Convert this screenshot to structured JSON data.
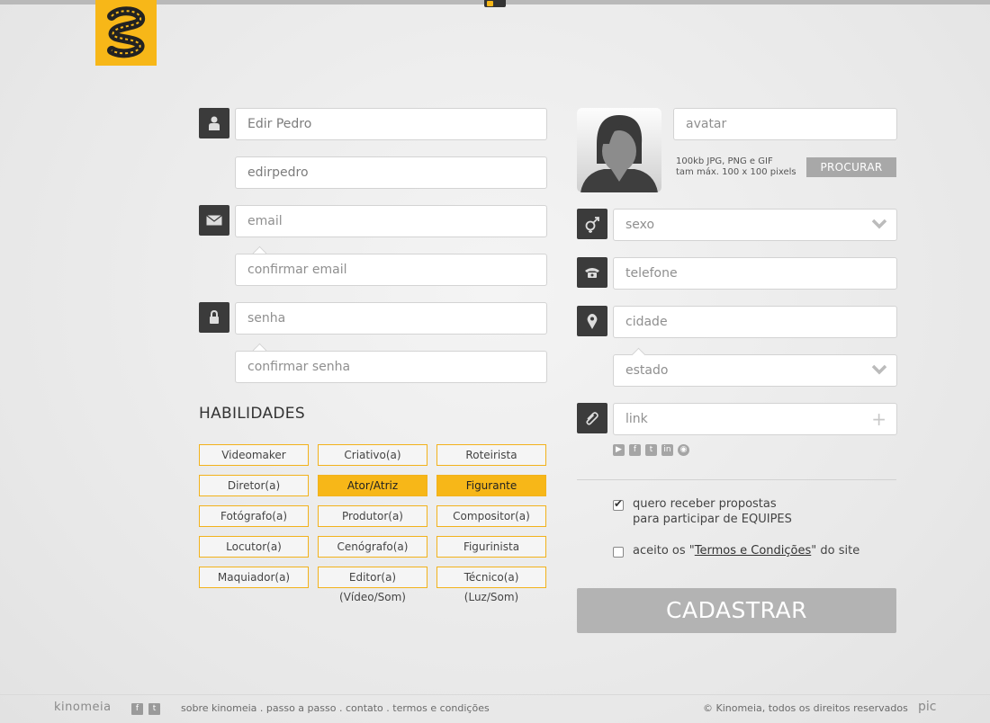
{
  "icons": {
    "user": "user-icon",
    "mail": "envelope-icon",
    "lock": "lock-icon",
    "gender": "gender-icon",
    "phone": "phone-icon",
    "location": "location-pin-icon",
    "clip": "paperclip-icon"
  },
  "colors": {
    "accent": "#f7b718",
    "dark": "#3b3b3b",
    "button": "#b3b3b3"
  },
  "form": {
    "nome": {
      "value": "Edir Pedro"
    },
    "usuario": {
      "value": "edirpedro"
    },
    "email": {
      "placeholder": "email"
    },
    "confirmar_email": {
      "placeholder": "confirmar email"
    },
    "senha": {
      "placeholder": "senha"
    },
    "confirmar_senha": {
      "placeholder": "confirmar senha"
    }
  },
  "skills": {
    "title": "HABILIDADES",
    "items": [
      {
        "label": "Videomaker",
        "selected": false
      },
      {
        "label": "Criativo(a)",
        "selected": false
      },
      {
        "label": "Roteirista",
        "selected": false
      },
      {
        "label": "Diretor(a)",
        "selected": false
      },
      {
        "label": "Ator/Atriz",
        "selected": true
      },
      {
        "label": "Figurante",
        "selected": true
      },
      {
        "label": "Fotógrafo(a)",
        "selected": false
      },
      {
        "label": "Produtor(a)",
        "selected": false
      },
      {
        "label": "Compositor(a)",
        "selected": false
      },
      {
        "label": "Locutor(a)",
        "selected": false
      },
      {
        "label": "Cenógrafo(a)",
        "selected": false
      },
      {
        "label": "Figurinista",
        "selected": false
      },
      {
        "label": "Maquiador(a)",
        "selected": false
      },
      {
        "label": "Editor(a) (Vídeo/Som)",
        "selected": false
      },
      {
        "label": "Técnico(a) (Luz/Som)",
        "selected": false
      }
    ]
  },
  "avatar": {
    "placeholder": "avatar",
    "hint_line1": "100kb JPG, PNG e GIF",
    "hint_line2": "tam máx. 100 x 100 pixels",
    "button": "PROCURAR"
  },
  "right": {
    "sexo": "sexo",
    "telefone": "telefone",
    "cidade": "cidade",
    "estado": "estado",
    "link": "link",
    "social": [
      "youtube-icon",
      "facebook-icon",
      "twitter-icon",
      "linkedin-icon",
      "web-icon"
    ]
  },
  "options": {
    "propostas_line1": "quero receber propostas",
    "propostas_line2": "para participar de EQUIPES",
    "propostas_checked": true,
    "termos_before": "aceito os \"",
    "termos_link": "Termos e Condições",
    "termos_after": "\" do site",
    "termos_checked": false
  },
  "submit": "CADASTRAR",
  "footer": {
    "brand": "kinomeia",
    "links": "sobre kinomeia . passo a passo . contato . termos e condições",
    "copyright": "© Kinomeia, todos os direitos reservados",
    "pic": "pic"
  }
}
